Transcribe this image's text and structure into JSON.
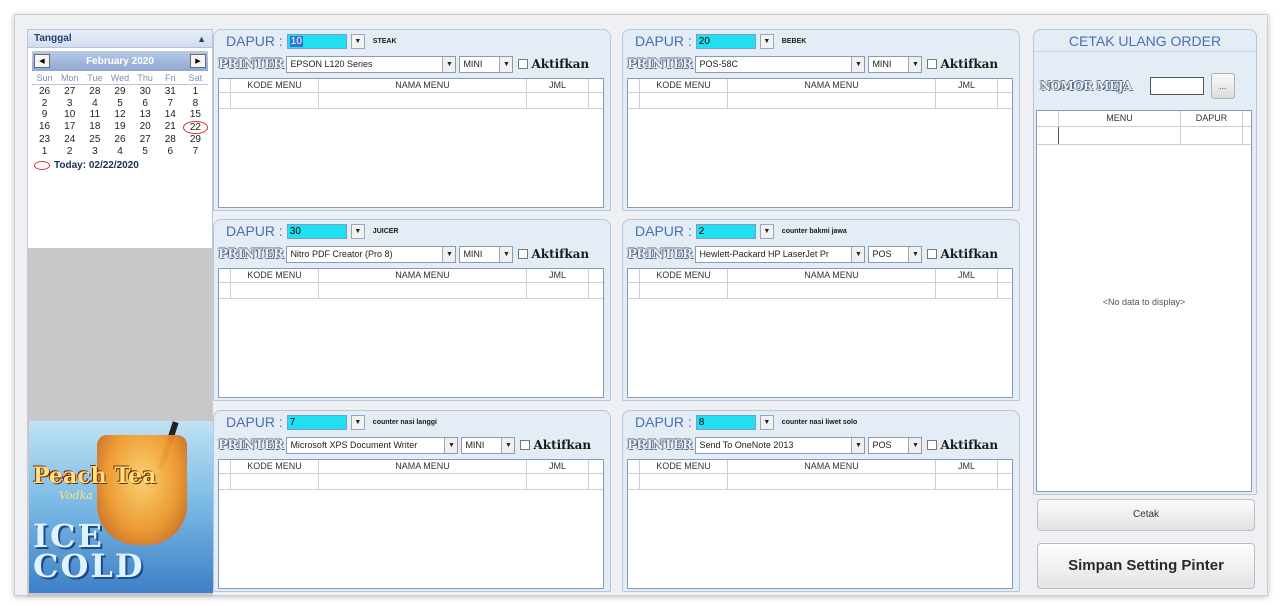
{
  "calendar": {
    "title": "Tanggal",
    "collapse_icon": "double-chevron-up",
    "month": "February 2020",
    "weekdays": [
      "Sun",
      "Mon",
      "Tue",
      "Wed",
      "Thu",
      "Fri",
      "Sat"
    ],
    "weeks": [
      [
        "26",
        "27",
        "28",
        "29",
        "30",
        "31",
        "1"
      ],
      [
        "2",
        "3",
        "4",
        "5",
        "6",
        "7",
        "8"
      ],
      [
        "9",
        "10",
        "11",
        "12",
        "13",
        "14",
        "15"
      ],
      [
        "16",
        "17",
        "18",
        "19",
        "20",
        "21",
        "22"
      ],
      [
        "23",
        "24",
        "25",
        "26",
        "27",
        "28",
        "29"
      ],
      [
        "1",
        "2",
        "3",
        "4",
        "5",
        "6",
        "7"
      ]
    ],
    "today_label": "Today: 02/22/2020"
  },
  "ad": {
    "line1": "Peach Tea",
    "line2": "Vodka",
    "line3": "ICE COLD"
  },
  "panels": [
    {
      "dapur_label": "DAPUR :",
      "dapur_value": "10",
      "dapur_name": "STEAK",
      "printer_label": "PRINTER",
      "printer": "EPSON L120 Series",
      "paper": "MINI",
      "aktif_label": "Aktifkan",
      "columns": [
        "KODE MENU",
        "NAMA MENU",
        "JML"
      ]
    },
    {
      "dapur_label": "DAPUR :",
      "dapur_value": "20",
      "dapur_name": "BEBEK",
      "printer_label": "PRINTER",
      "printer": "POS-58C",
      "paper": "MINI",
      "aktif_label": "Aktifkan",
      "columns": [
        "KODE MENU",
        "NAMA MENU",
        "JML"
      ]
    },
    {
      "dapur_label": "DAPUR :",
      "dapur_value": "30",
      "dapur_name": "JUICER",
      "printer_label": "PRINTER",
      "printer": "Nitro PDF Creator (Pro 8)",
      "paper": "MINI",
      "aktif_label": "Aktifkan",
      "columns": [
        "KODE MENU",
        "NAMA MENU",
        "JML"
      ]
    },
    {
      "dapur_label": "DAPUR :",
      "dapur_value": "2",
      "dapur_name": "counter bakmi jawa",
      "printer_label": "PRINTER",
      "printer": "Hewlett-Packard HP LaserJet Pr",
      "paper": "POS",
      "aktif_label": "Aktifkan",
      "columns": [
        "KODE MENU",
        "NAMA MENU",
        "JML"
      ]
    },
    {
      "dapur_label": "DAPUR :",
      "dapur_value": "7",
      "dapur_name": "counter nasi langgi",
      "printer_label": "PRINTER",
      "printer": "Microsoft XPS Document Writer",
      "paper": "MINI",
      "aktif_label": "Aktifkan",
      "columns": [
        "KODE MENU",
        "NAMA MENU",
        "JML"
      ]
    },
    {
      "dapur_label": "DAPUR :",
      "dapur_value": "8",
      "dapur_name": "counter nasi liwet solo",
      "printer_label": "PRINTER",
      "printer": "Send To OneNote 2013",
      "paper": "POS",
      "aktif_label": "Aktifkan",
      "columns": [
        "KODE MENU",
        "NAMA MENU",
        "JML"
      ]
    }
  ],
  "reprint": {
    "title": "CETAK ULANG ORDER",
    "nomor_label": "NOMOR MEJA",
    "nomor_value": "",
    "lookup_button": "...",
    "columns": [
      "MENU",
      "DAPUR"
    ],
    "empty_text": "<No data to display>",
    "cetak_button": "Cetak"
  },
  "save_button": "Simpan Setting Pinter",
  "colors": {
    "accent_blue": "#4a6fb0",
    "dapur_field": "#1ee0f0",
    "panel_bg": "#e4ecf6"
  }
}
